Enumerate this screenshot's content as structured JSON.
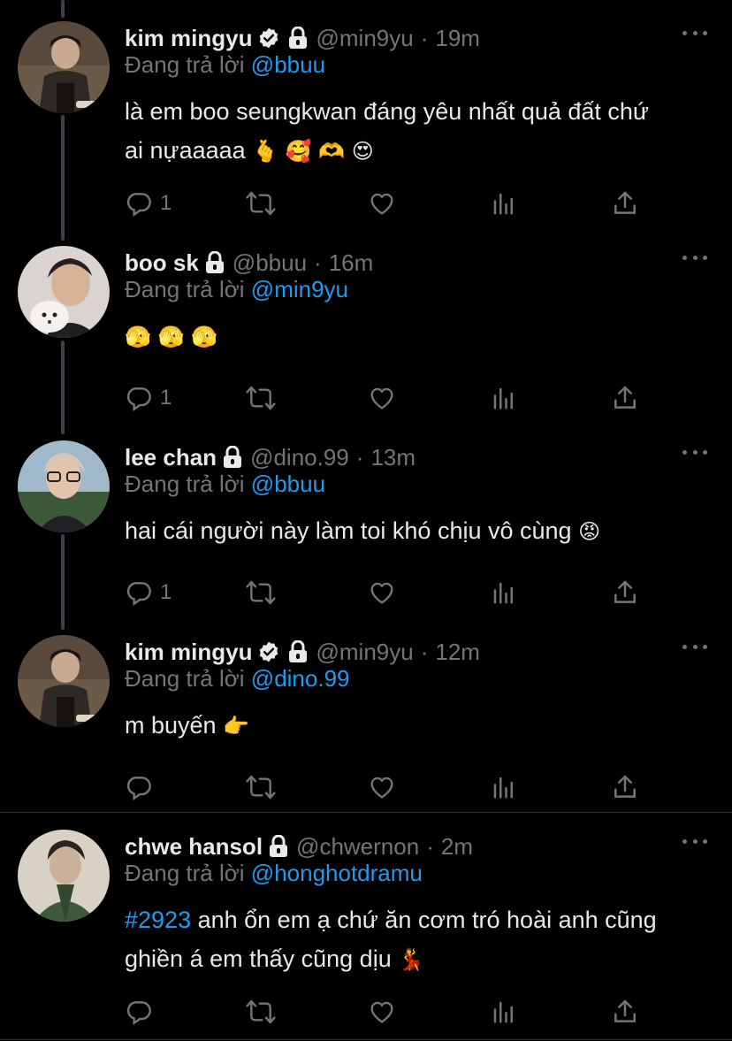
{
  "colors": {
    "background": "#000000",
    "text_primary": "#e7e9ea",
    "text_secondary": "#71767b",
    "accent": "#1d9bf0"
  },
  "replying_prefix": "Đang trả lời",
  "tweets": [
    {
      "name": "kim mingyu",
      "verified": true,
      "protected": true,
      "handle": "@min9yu",
      "dot": "·",
      "time": "19m",
      "replying_to": "@bbuu",
      "text_line1": "là em boo seungkwan đáng yêu nhất quả đất chứ",
      "text_line2": "ai nựaaaaa",
      "emojis": "🫰 🥰 🫶 😍",
      "reply_count": "1",
      "icons": [
        "reply-icon",
        "retweet-icon",
        "like-icon",
        "views-icon",
        "share-icon"
      ]
    },
    {
      "name": "boo sk",
      "verified": false,
      "protected": true,
      "handle": "@bbuu",
      "dot": "·",
      "time": "16m",
      "replying_to": "@min9yu",
      "emojis": "🫣 🫣 🫣",
      "reply_count": "1"
    },
    {
      "name": "lee chan",
      "verified": false,
      "protected": true,
      "handle": "@dino.99",
      "dot": "·",
      "time": "13m",
      "replying_to": "@bbuu",
      "text_line1": "hai cái người này làm toi khó chịu vô cùng",
      "emojis": "😡",
      "reply_count": "1"
    },
    {
      "name": "kim mingyu",
      "verified": true,
      "protected": true,
      "handle": "@min9yu",
      "dot": "·",
      "time": "12m",
      "replying_to": "@dino.99",
      "text_line1": "m buyến",
      "emojis": "👉",
      "reply_count": ""
    },
    {
      "name": "chwe hansol",
      "verified": false,
      "protected": true,
      "handle": "@chwernon",
      "dot": "·",
      "time": "2m",
      "replying_to": "@honghotdramu",
      "hashtag": "#2923",
      "text_line1": " anh ổn em ạ chứ ăn cơm tró hoài anh cũng",
      "text_line2": "ghiền á em thấy cũng dịu",
      "emojis": "💃",
      "reply_count": ""
    }
  ]
}
